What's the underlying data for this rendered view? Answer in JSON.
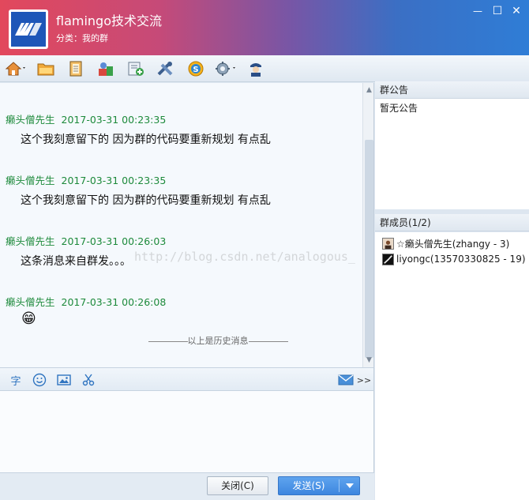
{
  "window": {
    "title": "flamingo技术交流",
    "subtitle": "分类：我的群",
    "minimize_glyph": "—",
    "maximize_glyph": "☐",
    "close_glyph": "✕"
  },
  "toolbar": {
    "icons": [
      "home-icon",
      "folder-icon",
      "notebook-icon",
      "app-icon",
      "add-member-icon",
      "tools-icon",
      "sogou-icon",
      "settings-icon",
      "user-card-icon"
    ]
  },
  "messages": [
    {
      "sender": "癞头僧先生",
      "time": "2017-03-31 00:23:35",
      "text": "这个我刻意留下的 因为群的代码要重新规划 有点乱"
    },
    {
      "sender": "癞头僧先生",
      "time": "2017-03-31 00:23:35",
      "text": "这个我刻意留下的 因为群的代码要重新规划 有点乱"
    },
    {
      "sender": "癞头僧先生",
      "time": "2017-03-31 00:26:03",
      "text": "这条消息来自群发。。。"
    },
    {
      "sender": "癞头僧先生",
      "time": "2017-03-31 00:26:08",
      "text": "😁"
    }
  ],
  "history_label": "以上是历史消息",
  "watermark": "http://blog.csdn.net/analogous_",
  "input_toolbar": {
    "font_label": "字",
    "more_label": ">>"
  },
  "buttons": {
    "close_label": "关闭(C)",
    "send_label": "发送(S)"
  },
  "notice": {
    "header": "群公告",
    "content": "暂无公告"
  },
  "members": {
    "header": "群成员(1/2)",
    "items": [
      {
        "label": "☆癞头僧先生(zhangy - 3)"
      },
      {
        "label": "liyongc(13570330825 - 19)"
      }
    ]
  },
  "colors": {
    "sender_green": "#1d8a3b",
    "send_blue": "#3d86df"
  }
}
